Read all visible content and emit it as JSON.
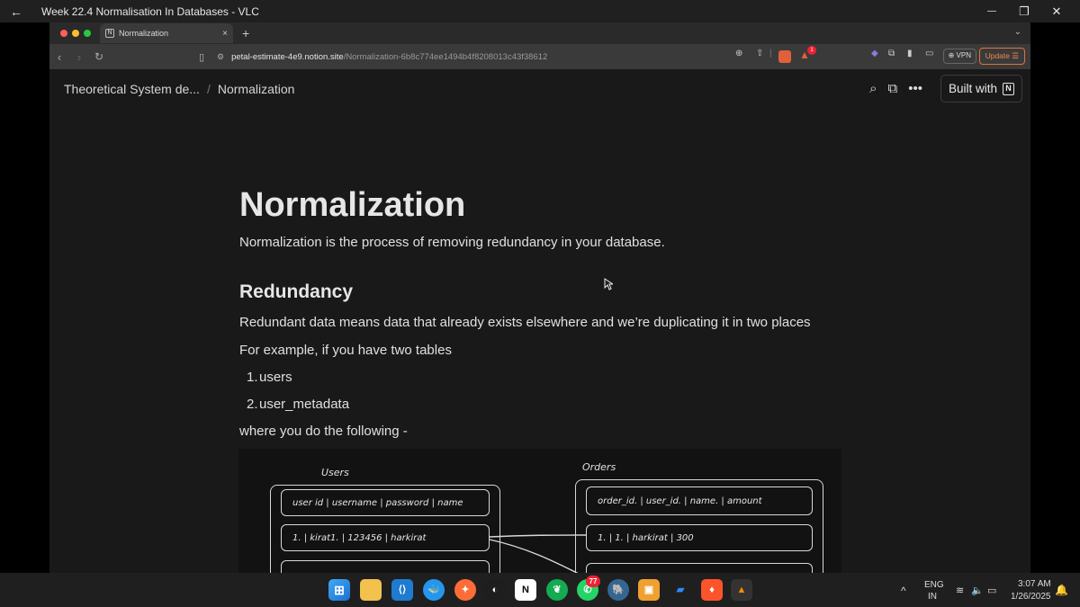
{
  "vlc": {
    "back_glyph": "←",
    "title": "Week 22.4   Normalisation In Databases - VLC",
    "minimize": "—",
    "restore": "❐",
    "close": "✕"
  },
  "browser": {
    "tab_title": "Normalization",
    "tab_favicon": "N",
    "tab_close": "×",
    "new_tab": "+",
    "tabs_menu": "⌄",
    "url_host": "petal-estimate-4e9.notion.site",
    "url_path": "/Normalization-6b8c774ee1494b4f8208013c43f38612",
    "shield_badge": "",
    "alert_badge": "1",
    "vpn_label": "⊕ VPN",
    "update_label": "Update ☰",
    "traffic_colors": [
      "#ff5f57",
      "#febc2e",
      "#28c840"
    ]
  },
  "notion": {
    "breadcrumb_parent": "Theoretical System de...",
    "breadcrumb_sep": "/",
    "breadcrumb_current": "Normalization",
    "built_with_label": "Built with",
    "built_with_logo": "N"
  },
  "doc": {
    "title": "Normalization",
    "intro": "Normalization is the process of removing redundancy in your database.",
    "section_heading": "Redundancy",
    "para1": "Redundant data means data that already exists elsewhere and we’re duplicating it in two places",
    "para2": "For example, if you have two tables",
    "list": [
      {
        "num": "1.",
        "text": "users"
      },
      {
        "num": "2.",
        "text": "user_metadata"
      }
    ],
    "para3": "where you do the following -"
  },
  "diagram": {
    "users_label": "Users",
    "orders_label": "Orders",
    "users_header": "user id  |  username  |  password  |  name",
    "users_row1": "1.      |  kirat1.      |  123456       |  harkirat",
    "orders_header": "order_id.  |  user_id.  |   name.      |  amount",
    "orders_row1": "1.              |          1.           |  harkirat  |         300"
  },
  "taskbar": {
    "lang_top": "ENG",
    "lang_bottom": "IN",
    "time": "3:07 AM",
    "date": "1/26/2025",
    "whatsapp_badge": "77",
    "tray_chevron": "^"
  }
}
